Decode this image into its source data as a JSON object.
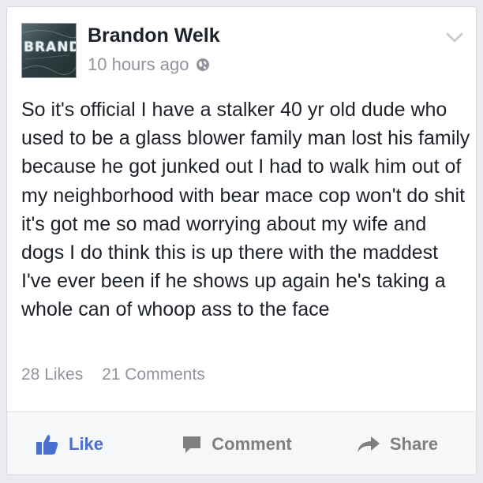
{
  "post": {
    "author": "Brandon Welk",
    "avatar_text": "BRANDO",
    "timestamp": "10 hours ago",
    "privacy_icon": "globe-icon",
    "menu_icon": "chevron-down-icon",
    "text": "So it's official I have a stalker 40 yr old dude who used to be a glass blower family man lost his family because he got junked out I had to walk him out of my neighborhood with bear mace cop won't do shit it's got me so mad worrying about my wife and dogs I do think this is up there with the maddest I've ever been if he shows up again he's taking a whole can of whoop ass to the face"
  },
  "stats": {
    "likes": "28 Likes",
    "comments": "21 Comments"
  },
  "actions": {
    "like_label": "Like",
    "comment_label": "Comment",
    "share_label": "Share"
  },
  "colors": {
    "like_blue": "#4b6fd0",
    "muted_gray": "#90949c",
    "action_gray": "#7f7f7f",
    "text": "#1d2129"
  }
}
